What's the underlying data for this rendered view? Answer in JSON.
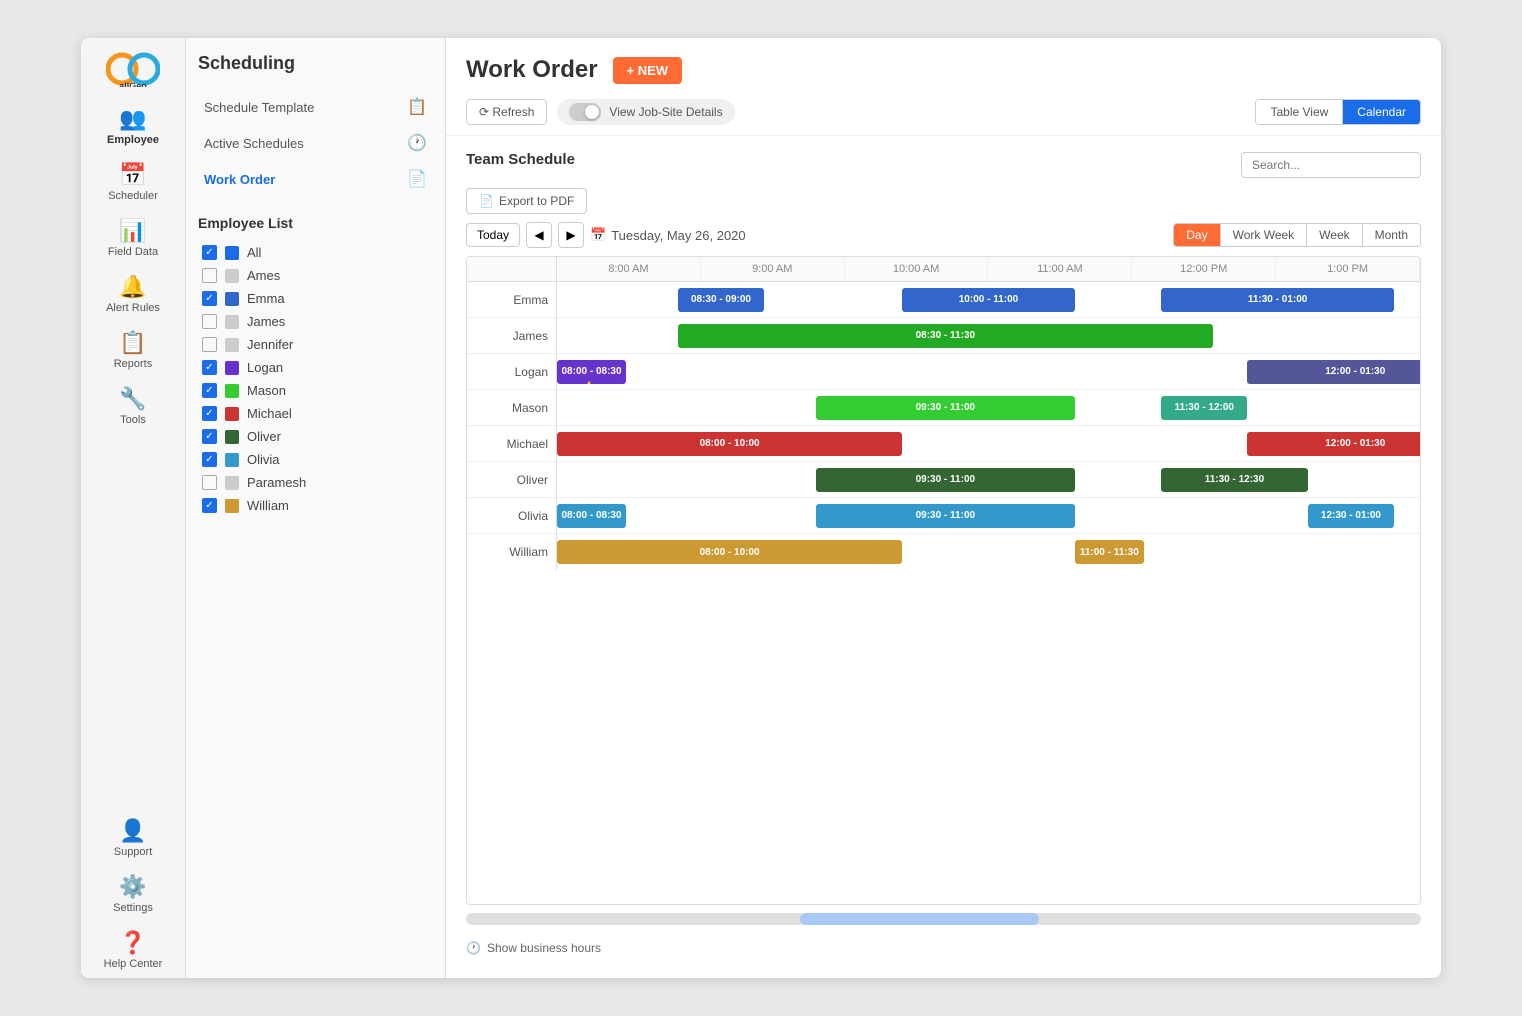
{
  "app": {
    "logo_text": "allGeo"
  },
  "sidebar": {
    "nav_items": [
      {
        "label": "Employee",
        "icon": "👥",
        "active": true
      },
      {
        "label": "Scheduler",
        "icon": "📅",
        "active": false
      },
      {
        "label": "Field Data",
        "icon": "📊",
        "active": false
      },
      {
        "label": "Alert Rules",
        "icon": "🔔",
        "active": false
      },
      {
        "label": "Reports",
        "icon": "📋",
        "active": false
      },
      {
        "label": "Tools",
        "icon": "🔧",
        "active": false
      }
    ],
    "bottom_items": [
      {
        "label": "Support",
        "icon": "👤"
      },
      {
        "label": "Settings",
        "icon": "⚙️"
      },
      {
        "label": "Help Center",
        "icon": "❓"
      }
    ]
  },
  "scheduling": {
    "title": "Scheduling",
    "menu_items": [
      {
        "label": "Schedule Template",
        "active": false
      },
      {
        "label": "Active Schedules",
        "active": false
      },
      {
        "label": "Work Order",
        "active": true
      }
    ]
  },
  "employee_list": {
    "title": "Employee List",
    "items": [
      {
        "label": "All",
        "checked": true,
        "color": "#1a6ce8"
      },
      {
        "label": "Ames",
        "checked": false,
        "color": "#cccccc"
      },
      {
        "label": "Emma",
        "checked": true,
        "color": "#3366cc"
      },
      {
        "label": "James",
        "checked": false,
        "color": "#cccccc"
      },
      {
        "label": "Jennifer",
        "checked": false,
        "color": "#cccccc"
      },
      {
        "label": "Logan",
        "checked": true,
        "color": "#6633cc"
      },
      {
        "label": "Mason",
        "checked": true,
        "color": "#33cc33"
      },
      {
        "label": "Michael",
        "checked": true,
        "color": "#cc3333"
      },
      {
        "label": "Oliver",
        "checked": true,
        "color": "#336633"
      },
      {
        "label": "Olivia",
        "checked": true,
        "color": "#3399cc"
      },
      {
        "label": "Paramesh",
        "checked": false,
        "color": "#cccccc"
      },
      {
        "label": "William",
        "checked": true,
        "color": "#cc9933"
      }
    ]
  },
  "work_order": {
    "title": "Work Order",
    "new_button": "+ NEW",
    "refresh_button": "⟳ Refresh",
    "toggle_label": "View Job-Site Details",
    "table_view_label": "Table View",
    "calendar_view_label": "Calendar",
    "team_schedule_label": "Team Schedule",
    "export_button": "Export to PDF",
    "today_button": "Today",
    "date_label": "Tuesday, May 26, 2020",
    "day_views": [
      "Day",
      "Work Week",
      "Week",
      "Month"
    ],
    "active_day_view": "Day"
  },
  "time_slots": [
    "8:00 AM",
    "9:00 AM",
    "10:00 AM",
    "11:00 AM",
    "12:00 PM",
    "1:00 PM"
  ],
  "employees": [
    {
      "name": "Emma",
      "events": [
        {
          "label": "08:30 - 09:00",
          "start_pct": 14,
          "width_pct": 10,
          "color": "#3366cc"
        },
        {
          "label": "10:00 - 11:00",
          "start_pct": 40,
          "width_pct": 20,
          "color": "#3366cc"
        },
        {
          "label": "11:30 - 01:00",
          "start_pct": 70,
          "width_pct": 27,
          "color": "#3366cc"
        }
      ]
    },
    {
      "name": "James",
      "events": [
        {
          "label": "08:30 - 11:30",
          "start_pct": 14,
          "width_pct": 62,
          "color": "#22aa22"
        }
      ]
    },
    {
      "name": "Logan",
      "events": [
        {
          "label": "08:00 - 08:30",
          "start_pct": 0,
          "width_pct": 8,
          "color": "#6633cc",
          "tooltip": "08:00 - 08:30"
        },
        {
          "label": "12:00 - 01:30",
          "start_pct": 80,
          "width_pct": 25,
          "color": "#555599"
        }
      ]
    },
    {
      "name": "Mason",
      "events": [
        {
          "label": "09:30 - 11:00",
          "start_pct": 30,
          "width_pct": 30,
          "color": "#33cc33"
        },
        {
          "label": "11:30 - 12:00",
          "start_pct": 70,
          "width_pct": 10,
          "color": "#33aa88"
        }
      ]
    },
    {
      "name": "Michael",
      "events": [
        {
          "label": "08:00 - 10:00",
          "start_pct": 0,
          "width_pct": 40,
          "color": "#cc3333"
        },
        {
          "label": "12:00 - 01:30",
          "start_pct": 80,
          "width_pct": 25,
          "color": "#cc3333"
        }
      ]
    },
    {
      "name": "Oliver",
      "events": [
        {
          "label": "09:30 - 11:00",
          "start_pct": 30,
          "width_pct": 30,
          "color": "#336633"
        },
        {
          "label": "11:30 - 12:30",
          "start_pct": 70,
          "width_pct": 17,
          "color": "#336633"
        }
      ]
    },
    {
      "name": "Olivia",
      "events": [
        {
          "label": "08:00 - 08:30",
          "start_pct": 0,
          "width_pct": 8,
          "color": "#3399cc"
        },
        {
          "label": "09:30 - 11:00",
          "start_pct": 30,
          "width_pct": 30,
          "color": "#3399cc"
        },
        {
          "label": "12:30 - 01:00",
          "start_pct": 87,
          "width_pct": 10,
          "color": "#3399cc"
        }
      ]
    },
    {
      "name": "William",
      "events": [
        {
          "label": "08:00 - 10:00",
          "start_pct": 0,
          "width_pct": 40,
          "color": "#cc9933"
        },
        {
          "label": "11:00 - 11:30",
          "start_pct": 60,
          "width_pct": 8,
          "color": "#cc9933"
        }
      ]
    }
  ],
  "business_hours_label": "Show business hours"
}
